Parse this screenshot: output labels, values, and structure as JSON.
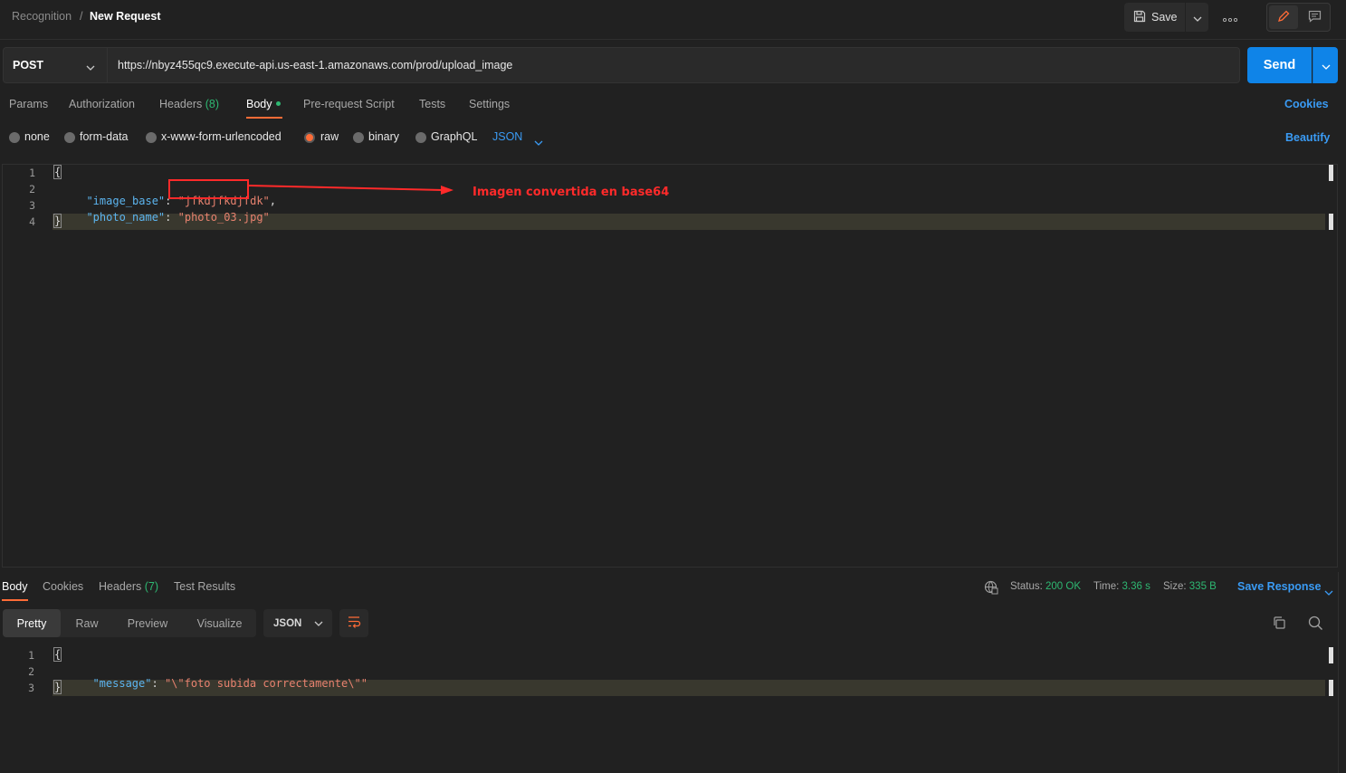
{
  "breadcrumb": {
    "parent": "Recognition",
    "separator": "/",
    "current": "New Request"
  },
  "toolbar": {
    "save_label": "Save",
    "more_label": "•••"
  },
  "request": {
    "method": "POST",
    "url": "https://nbyz455qc9.execute-api.us-east-1.amazonaws.com/prod/upload_image",
    "send_label": "Send"
  },
  "request_tabs": {
    "params": "Params",
    "authorization": "Authorization",
    "headers": "Headers",
    "headers_count": "(8)",
    "body": "Body",
    "pre_request": "Pre-request Script",
    "tests": "Tests",
    "settings": "Settings",
    "cookies": "Cookies"
  },
  "body_types": {
    "none": "none",
    "form_data": "form-data",
    "urlencoded": "x-www-form-urlencoded",
    "raw": "raw",
    "binary": "binary",
    "graphql": "GraphQL",
    "format": "JSON",
    "beautify": "Beautify",
    "selected": "raw"
  },
  "request_body": {
    "line_numbers": [
      "1",
      "2",
      "3",
      "4"
    ],
    "open_brace": "{",
    "close_brace": "}",
    "key1": "\"image_base\"",
    "val1": "\"jfkdjfkdjfdk\"",
    "key2": "\"photo_name\"",
    "val2": "\"photo_03.jpg\"",
    "colon": ":",
    "comma": ","
  },
  "annotation": {
    "text": "Imagen convertida en base64",
    "color": "#ff2a2a"
  },
  "response": {
    "tabs": {
      "body": "Body",
      "cookies": "Cookies",
      "headers": "Headers",
      "headers_count": "(7)",
      "test_results": "Test Results"
    },
    "status_label": "Status:",
    "status_value": "200 OK",
    "time_label": "Time:",
    "time_value": "3.36 s",
    "size_label": "Size:",
    "size_value": "335 B",
    "save_response": "Save Response",
    "formats": {
      "pretty": "Pretty",
      "raw": "Raw",
      "preview": "Preview",
      "visualize": "Visualize"
    },
    "format_select": "JSON",
    "line_numbers": [
      "1",
      "2",
      "3"
    ],
    "open_brace": "{",
    "close_brace": "}",
    "key": "\"message\"",
    "value": "\"\\\"foto subida correctamente\\\"\""
  },
  "colors": {
    "accent": "#ff6c37",
    "primary": "#0f84e8",
    "success": "#2eb872",
    "link": "#3a9bf4"
  }
}
